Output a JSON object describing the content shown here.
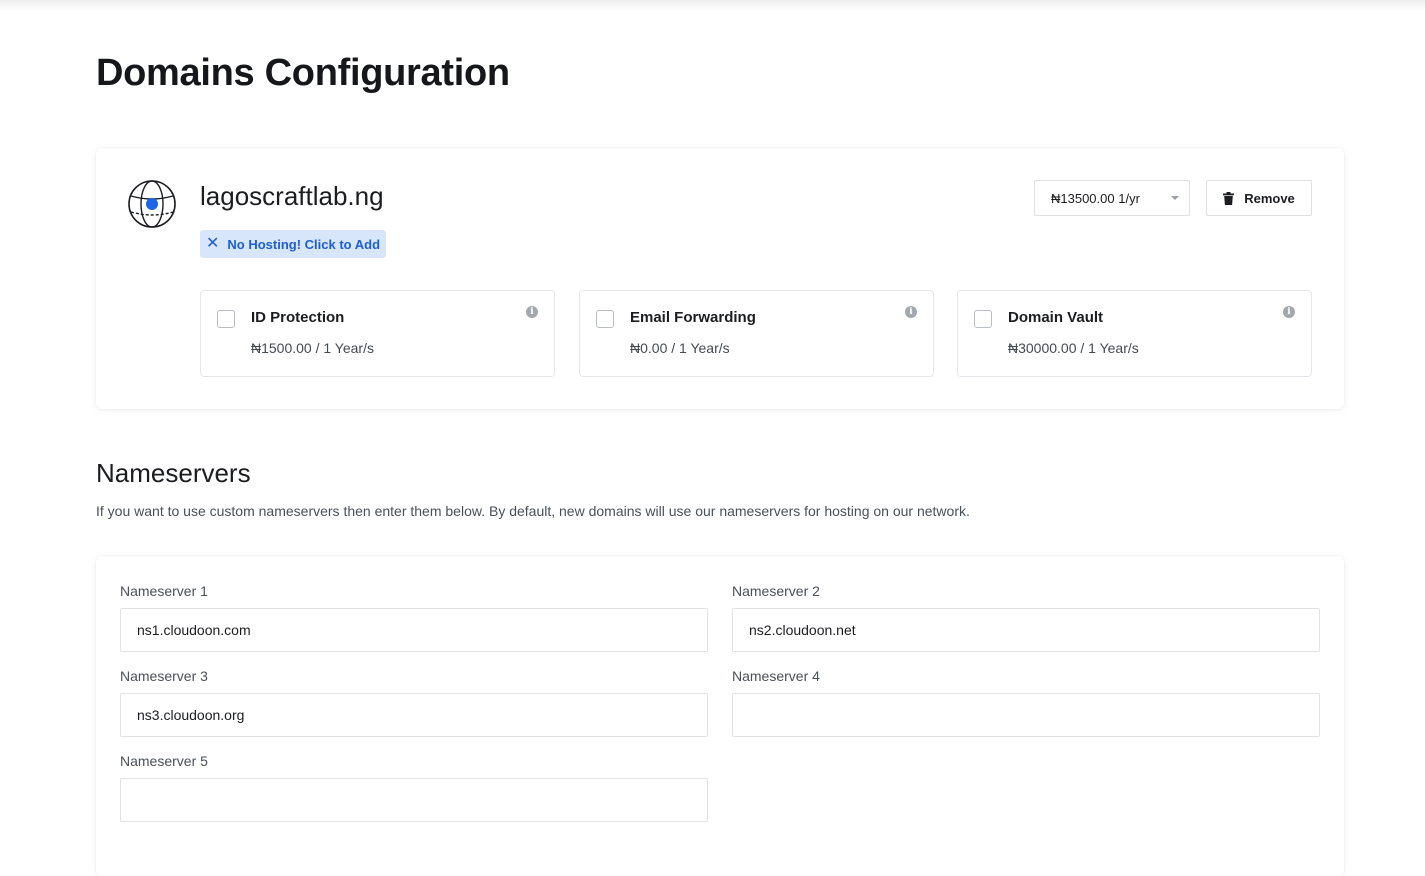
{
  "page": {
    "title": "Domains Configuration"
  },
  "domain": {
    "name": "lagoscraftlab.ng",
    "hosting_badge": "No Hosting! Click to Add",
    "price_option": "₦13500.00 1/yr",
    "remove_label": "Remove",
    "addons": [
      {
        "title": "ID Protection",
        "price": "₦1500.00 / 1 Year/s",
        "checked": false
      },
      {
        "title": "Email Forwarding",
        "price": "₦0.00 / 1 Year/s",
        "checked": false
      },
      {
        "title": "Domain Vault",
        "price": "₦30000.00 / 1 Year/s",
        "checked": false
      }
    ]
  },
  "nameservers": {
    "title": "Nameservers",
    "description": "If you want to use custom nameservers then enter them below. By default, new domains will use our nameservers for hosting on our network.",
    "fields": [
      {
        "label": "Nameserver 1",
        "value": "ns1.cloudoon.com"
      },
      {
        "label": "Nameserver 2",
        "value": "ns2.cloudoon.net"
      },
      {
        "label": "Nameserver 3",
        "value": "ns3.cloudoon.org"
      },
      {
        "label": "Nameserver 4",
        "value": ""
      },
      {
        "label": "Nameserver 5",
        "value": ""
      }
    ]
  },
  "colors": {
    "accent": "#1d5fd0",
    "badge_bg": "#d7e6fb",
    "globe_dot": "#1a66e6"
  },
  "icons": {
    "domain": "globe-icon",
    "remove": "trash-icon",
    "badge": "close-icon",
    "addon_info": "info-icon",
    "select": "chevron-down-icon"
  }
}
